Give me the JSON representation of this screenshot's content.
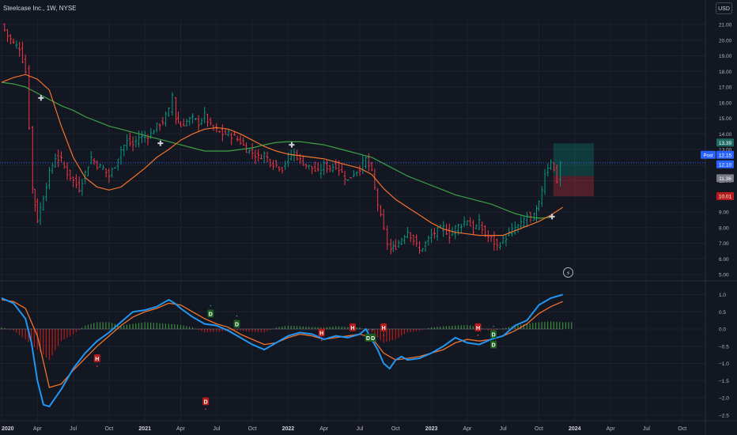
{
  "header": {
    "symbol": "Steelcase Inc., 1W, NYSE",
    "currency": "USD",
    "bolt_icon": "lightning-icon"
  },
  "colors": {
    "background": "#131722",
    "grid": "#1e222d",
    "up_bar": "#089981",
    "down_bar": "#f23645",
    "fast_ma": "#f0732b",
    "slow_ma": "#3ba146",
    "price_line": "#2962ff",
    "macd": "#2196f3",
    "signal": "#f0732b",
    "hist_pos": "#388e3c",
    "hist_neg": "#b71c1c",
    "axis_text": "#b2b5be",
    "cross_marker": "#d1d4dc"
  },
  "axes": {
    "x_ticks": [
      {
        "label": "2020",
        "t": 0
      },
      {
        "label": "Apr",
        "t": 3
      },
      {
        "label": "Jul",
        "t": 6
      },
      {
        "label": "Oct",
        "t": 9
      },
      {
        "label": "2021",
        "t": 12
      },
      {
        "label": "Apr",
        "t": 15
      },
      {
        "label": "Jul",
        "t": 18
      },
      {
        "label": "Oct",
        "t": 21
      },
      {
        "label": "2022",
        "t": 24
      },
      {
        "label": "Apr",
        "t": 27
      },
      {
        "label": "Jul",
        "t": 30
      },
      {
        "label": "Oct",
        "t": 33
      },
      {
        "label": "2023",
        "t": 36
      },
      {
        "label": "Apr",
        "t": 39
      },
      {
        "label": "Jul",
        "t": 42
      },
      {
        "label": "Oct",
        "t": 45
      },
      {
        "label": "2024",
        "t": 48
      },
      {
        "label": "Apr",
        "t": 51
      },
      {
        "label": "Jul",
        "t": 54
      },
      {
        "label": "Oct",
        "t": 57
      }
    ],
    "price_ticks": [
      "21.00",
      "20.00",
      "19.00",
      "18.00",
      "17.00",
      "16.00",
      "15.00",
      "14.00",
      "13.00",
      "12.00",
      "11.00",
      "10.00",
      "9.00",
      "8.00",
      "7.00",
      "6.00",
      "5.00"
    ],
    "osc_ticks": [
      "1.0",
      "0.5",
      "0.0",
      "−0.5",
      "−1.0",
      "−1.5",
      "−2.0",
      "−2.5"
    ]
  },
  "price_labels": [
    {
      "text": "13.39",
      "kind": "target",
      "value": 13.39
    },
    {
      "text": "12.15",
      "kind": "current",
      "value": 12.15,
      "prefix": "Post"
    },
    {
      "text": "12.10",
      "kind": "entry",
      "value": 12.1
    },
    {
      "text": "11.36",
      "kind": "gray",
      "value": 11.36
    },
    {
      "text": "10.01",
      "kind": "stop",
      "value": 10.01
    }
  ],
  "position_box": {
    "t_start": 46.2,
    "t_end": 49.6,
    "entry": 11.3,
    "target": 13.39,
    "stop": 10.01
  },
  "chart_data": [
    {
      "type": "bar",
      "title": "Steelcase Inc., 1W, NYSE",
      "unit": "USD",
      "ylim": [
        5,
        21.5
      ],
      "time_unit": "months since Jan 2020",
      "close": {
        "t": [
          0,
          0.5,
          1,
          1.5,
          2,
          2.3,
          2.6,
          3,
          3.5,
          4,
          4.5,
          5,
          5.5,
          6,
          6.5,
          7,
          7.5,
          8,
          8.5,
          9,
          9.5,
          10,
          10.5,
          11,
          11.5,
          12,
          12.5,
          13,
          13.5,
          14,
          14.3,
          14.6,
          15,
          15.5,
          16,
          16.5,
          17,
          17.5,
          18,
          18.5,
          19,
          19.5,
          20,
          20.5,
          21,
          21.5,
          22,
          22.5,
          23,
          23.5,
          24,
          24.5,
          25,
          25.5,
          26,
          26.5,
          27,
          27.5,
          28,
          28.5,
          29,
          29.5,
          30,
          30.5,
          31,
          31.5,
          32,
          32.3,
          32.6,
          33,
          33.5,
          34,
          34.5,
          35,
          35.5,
          36,
          36.5,
          37,
          37.5,
          38,
          38.5,
          39,
          39.5,
          40,
          40.5,
          41,
          41.5,
          42,
          42.5,
          43,
          43.5,
          44,
          44.3,
          44.6,
          45,
          45.5,
          46,
          46.5,
          46.8
        ],
        "values": [
          21.0,
          20.3,
          19.8,
          19.5,
          18.0,
          14.5,
          10.5,
          8.5,
          10.0,
          11.5,
          12.5,
          12.3,
          11.5,
          11.0,
          10.5,
          11.5,
          12.5,
          12.0,
          11.8,
          11.3,
          12.0,
          13.0,
          13.5,
          13.3,
          13.8,
          13.8,
          14.0,
          14.5,
          14.8,
          15.5,
          16.5,
          15.0,
          14.5,
          14.8,
          15.0,
          14.7,
          15.2,
          14.5,
          14.2,
          14.0,
          14.0,
          13.8,
          13.5,
          13.0,
          12.8,
          12.5,
          12.7,
          12.2,
          12.0,
          11.8,
          12.5,
          12.8,
          12.3,
          12.0,
          11.8,
          11.5,
          12.0,
          11.8,
          12.0,
          11.5,
          11.0,
          11.5,
          11.8,
          12.4,
          11.5,
          9.5,
          7.8,
          7.0,
          6.6,
          6.8,
          7.3,
          7.8,
          7.2,
          6.5,
          7.0,
          7.5,
          7.8,
          8.0,
          7.5,
          8.0,
          8.2,
          8.5,
          7.8,
          8.3,
          7.5,
          7.3,
          6.8,
          7.2,
          7.6,
          8.0,
          8.2,
          8.8,
          8.6,
          8.7,
          9.5,
          11.5,
          12.3,
          11.0,
          12.15
        ]
      },
      "series": [
        {
          "name": "",
          "t": [
            0,
            1,
            2,
            3,
            4,
            5,
            6,
            7,
            8,
            9,
            10,
            11,
            12,
            13,
            14,
            15,
            16,
            17,
            18,
            19,
            20,
            21,
            22,
            23,
            24,
            25,
            26,
            27,
            28,
            29,
            30,
            31,
            32,
            33,
            34,
            35,
            36,
            37,
            38,
            39,
            40,
            41,
            42,
            43,
            44,
            45,
            46,
            47
          ],
          "values": [
            17.3,
            17.6,
            17.8,
            17.5,
            16.8,
            14.5,
            12.5,
            11.2,
            10.6,
            10.4,
            10.6,
            11.2,
            11.8,
            12.5,
            13.0,
            13.6,
            14.0,
            14.3,
            14.4,
            14.3,
            14.0,
            13.6,
            13.2,
            12.9,
            12.7,
            12.6,
            12.5,
            12.4,
            12.2,
            12.0,
            11.8,
            11.4,
            10.5,
            9.8,
            9.3,
            8.8,
            8.3,
            7.9,
            7.7,
            7.6,
            7.5,
            7.5,
            7.5,
            7.8,
            8.1,
            8.4,
            8.8,
            9.3
          ]
        },
        {
          "name": "",
          "t": [
            0,
            1,
            2,
            3,
            4,
            5,
            6,
            7,
            8,
            9,
            10,
            11,
            12,
            13,
            14,
            15,
            16,
            17,
            18,
            19,
            20,
            21,
            22,
            23,
            24,
            25,
            26,
            27,
            28,
            29,
            30,
            31,
            32,
            33,
            34,
            35,
            36,
            37,
            38,
            39,
            40,
            41,
            42,
            43,
            44,
            45,
            46
          ],
          "values": [
            17.3,
            17.2,
            17.0,
            16.6,
            16.2,
            15.8,
            15.5,
            15.1,
            14.8,
            14.5,
            14.3,
            14.1,
            13.9,
            13.7,
            13.5,
            13.3,
            13.1,
            12.9,
            12.9,
            12.9,
            13.0,
            13.1,
            13.3,
            13.45,
            13.5,
            13.5,
            13.4,
            13.3,
            13.1,
            12.9,
            12.7,
            12.5,
            12.1,
            11.7,
            11.3,
            11.0,
            10.7,
            10.4,
            10.1,
            9.9,
            9.7,
            9.5,
            9.2,
            8.9,
            8.7,
            8.6,
            8.65
          ]
        }
      ],
      "cross_markers": [
        {
          "t": 3.3,
          "value": 16.3
        },
        {
          "t": 13.3,
          "value": 13.4
        },
        {
          "t": 24.3,
          "value": 13.3
        },
        {
          "t": 46.1,
          "value": 8.7
        }
      ]
    },
    {
      "type": "line",
      "title": "",
      "ylim": [
        -2.6,
        1.3
      ],
      "time_unit": "months since Jan 2020",
      "series": [
        {
          "name": "",
          "t": [
            0,
            1,
            2,
            2.5,
            3,
            3.5,
            4,
            5,
            6,
            7,
            8,
            9,
            10,
            11,
            12,
            13,
            14,
            14.5,
            15,
            16,
            17,
            18,
            19,
            20,
            21,
            22,
            23,
            24,
            25,
            26,
            27,
            28,
            29,
            30,
            30.5,
            31,
            31.5,
            32,
            32.5,
            33,
            33.5,
            34,
            35,
            36,
            37,
            38,
            39,
            40,
            41,
            42,
            43,
            44,
            45,
            46,
            47
          ],
          "values": [
            0.9,
            0.75,
            0.3,
            -0.4,
            -1.5,
            -2.2,
            -2.25,
            -1.75,
            -1.15,
            -0.7,
            -0.35,
            -0.1,
            0.2,
            0.5,
            0.55,
            0.65,
            0.85,
            0.75,
            0.6,
            0.35,
            0.15,
            0.1,
            -0.05,
            -0.25,
            -0.45,
            -0.6,
            -0.4,
            -0.2,
            -0.1,
            -0.15,
            -0.3,
            -0.2,
            -0.25,
            -0.15,
            0.0,
            -0.3,
            -0.6,
            -1.0,
            -1.15,
            -0.9,
            -0.8,
            -0.9,
            -0.85,
            -0.7,
            -0.5,
            -0.25,
            -0.4,
            -0.45,
            -0.3,
            -0.2,
            0.1,
            0.25,
            0.7,
            0.9,
            1.0
          ]
        },
        {
          "name": "",
          "t": [
            0,
            1,
            2,
            3,
            4,
            5,
            6,
            7,
            8,
            9,
            10,
            11,
            12,
            13,
            14,
            15,
            16,
            17,
            18,
            19,
            20,
            21,
            22,
            23,
            24,
            25,
            26,
            27,
            28,
            29,
            30,
            31,
            32,
            33,
            34,
            35,
            36,
            37,
            38,
            39,
            40,
            41,
            42,
            43,
            44,
            45,
            46,
            47
          ],
          "values": [
            0.85,
            0.8,
            0.6,
            -0.2,
            -1.7,
            -1.6,
            -1.2,
            -0.85,
            -0.5,
            -0.2,
            0.1,
            0.35,
            0.5,
            0.6,
            0.75,
            0.7,
            0.5,
            0.3,
            0.15,
            0.05,
            -0.15,
            -0.3,
            -0.45,
            -0.4,
            -0.25,
            -0.15,
            -0.2,
            -0.3,
            -0.25,
            -0.2,
            -0.15,
            -0.25,
            -0.7,
            -0.9,
            -0.85,
            -0.8,
            -0.7,
            -0.6,
            -0.4,
            -0.3,
            -0.35,
            -0.3,
            -0.2,
            -0.05,
            0.15,
            0.45,
            0.65,
            0.8
          ]
        }
      ],
      "histogram": {
        "t": [
          0,
          1,
          2,
          3,
          4,
          5,
          6,
          7,
          8,
          9,
          10,
          11,
          12,
          13,
          14,
          15,
          16,
          17,
          18,
          19,
          20,
          21,
          22,
          23,
          24,
          25,
          26,
          27,
          28,
          29,
          30,
          31,
          32,
          33,
          34,
          35,
          36,
          37,
          38,
          39,
          40,
          41,
          42,
          43,
          44,
          45,
          46,
          47
        ],
        "values": [
          0.05,
          -0.05,
          -0.3,
          -0.6,
          -0.9,
          -0.35,
          -0.15,
          0.1,
          0.2,
          0.2,
          0.1,
          0.15,
          0.2,
          0.18,
          0.15,
          0.12,
          0.05,
          -0.1,
          -0.08,
          -0.06,
          -0.05,
          -0.08,
          -0.1,
          0.05,
          0.1,
          0.08,
          0.06,
          0.05,
          0.08,
          0.06,
          0.05,
          -0.1,
          -0.4,
          -0.3,
          -0.1,
          -0.05,
          0.05,
          0.08,
          0.1,
          0.12,
          0.05,
          -0.08,
          0.02,
          0.1,
          0.15,
          0.2,
          0.22,
          0.2
        ]
      },
      "markers": [
        {
          "text": "H",
          "kind": "sell",
          "t": 8.0,
          "value": -0.85
        },
        {
          "text": "D",
          "kind": "buy",
          "t": 17.5,
          "value": 0.45
        },
        {
          "text": "D",
          "kind": "buy",
          "t": 19.7,
          "value": 0.15
        },
        {
          "text": "H",
          "kind": "sell",
          "t": 26.8,
          "value": -0.1
        },
        {
          "text": "H",
          "kind": "sell",
          "t": 29.4,
          "value": 0.05
        },
        {
          "text": "D",
          "kind": "buy",
          "t": 30.7,
          "value": -0.25
        },
        {
          "text": "D",
          "kind": "buy",
          "t": 31.1,
          "value": -0.25
        },
        {
          "text": "H",
          "kind": "sell",
          "t": 32.0,
          "value": 0.05
        },
        {
          "text": "H",
          "kind": "sell",
          "t": 39.9,
          "value": 0.05
        },
        {
          "text": "D",
          "kind": "buy",
          "t": 41.2,
          "value": -0.15
        },
        {
          "text": "D",
          "kind": "buy",
          "t": 41.2,
          "value": -0.45
        },
        {
          "text": "D",
          "kind": "sell",
          "t": 17.1,
          "value": -2.1
        }
      ]
    }
  ]
}
